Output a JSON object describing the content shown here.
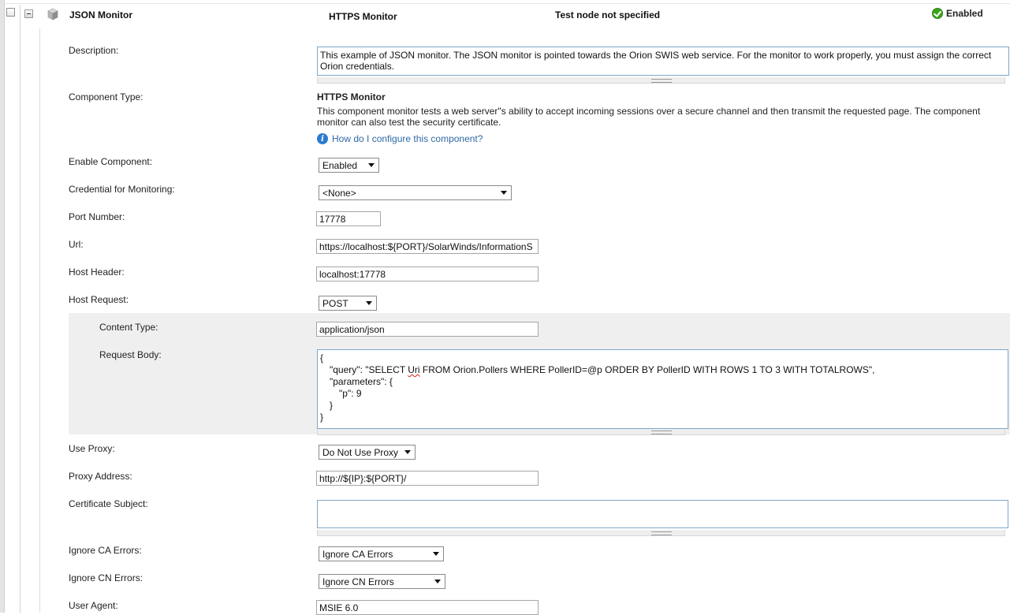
{
  "header": {
    "monitor_name": "JSON Monitor",
    "monitor_type": "HTTPS Monitor",
    "test_node": "Test node not specified",
    "status": "Enabled"
  },
  "form": {
    "description_label": "Description:",
    "description_value": "This example of JSON monitor. The JSON monitor is pointed towards the Orion SWIS web service. For the monitor to work properly, you must assign the correct Orion credentials.",
    "component_type_label": "Component Type:",
    "component_type_title": "HTTPS Monitor",
    "component_type_desc": "This component monitor tests a web server\"s ability to accept incoming sessions over a secure channel and then transmit the requested page. The component monitor can also test the security certificate.",
    "help_link": "How do I configure this component?",
    "enable_component_label": "Enable Component:",
    "enable_component_value": "Enabled",
    "credential_label": "Credential for Monitoring:",
    "credential_value": "<None>",
    "port_label": "Port Number:",
    "port_value": "17778",
    "url_label": "Url:",
    "url_value": "https://localhost:${PORT}/SolarWinds/InformationS",
    "host_header_label": "Host Header:",
    "host_header_value": "localhost:17778",
    "host_request_label": "Host Request:",
    "host_request_value": "POST",
    "content_type_label": "Content Type:",
    "content_type_value": "application/json",
    "request_body_label": "Request Body:",
    "request_body_lines": {
      "l1": "{",
      "l2a": "\"query\": \"SELECT ",
      "l2b": "Uri",
      "l2c": " FROM Orion.Pollers WHERE PollerID=@p ORDER BY PollerID WITH ROWS 1 TO 3 WITH TOTALROWS\",",
      "l3": "\"parameters\": {",
      "l4": "\"p\": 9",
      "l5": "}",
      "l6": "}"
    },
    "use_proxy_label": "Use Proxy:",
    "use_proxy_value": "Do Not Use Proxy",
    "proxy_address_label": "Proxy Address:",
    "proxy_address_value": "http://${IP}:${PORT}/",
    "cert_subject_label": "Certificate Subject:",
    "cert_subject_value": "",
    "ignore_ca_label": "Ignore CA Errors:",
    "ignore_ca_value": "Ignore CA Errors",
    "ignore_cn_label": "Ignore CN Errors:",
    "ignore_cn_value": "Ignore CN Errors",
    "user_agent_label": "User Agent:",
    "user_agent_value": "MSIE 6.0"
  },
  "icons": {
    "status": "check-circle-icon",
    "help": "info-icon",
    "type": "cube-icon"
  },
  "colors": {
    "status_green": "#3aa51c",
    "link_blue": "#2f6aa6",
    "section_gray": "#efefef"
  }
}
